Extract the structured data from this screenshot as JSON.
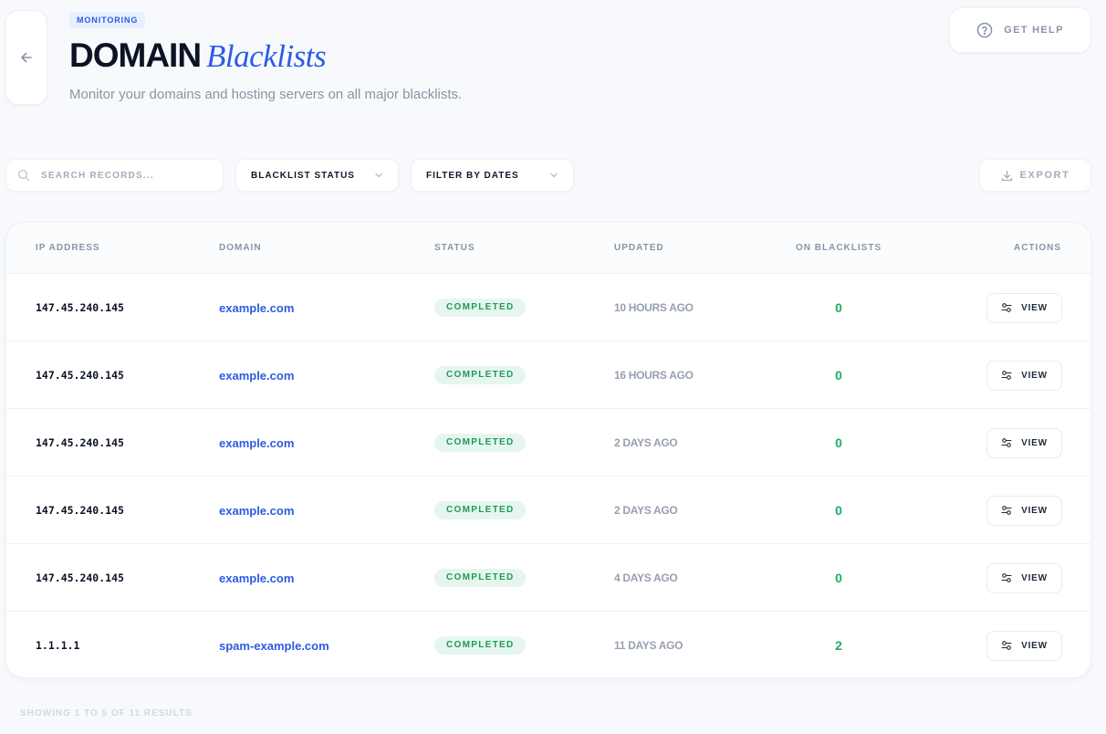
{
  "header": {
    "badge": "MONITORING",
    "title_strong": "DOMAIN",
    "title_italic": "Blacklists",
    "subtitle": "Monitor your domains and hosting servers on all major blacklists.",
    "help_label": "GET HELP"
  },
  "toolbar": {
    "search_placeholder": "SEARCH RECORDS...",
    "blacklist_status_label": "BLACKLIST STATUS",
    "filter_dates_label": "FILTER BY DATES",
    "export_label": "EXPORT"
  },
  "table": {
    "columns": {
      "ip": "IP ADDRESS",
      "domain": "DOMAIN",
      "status": "STATUS",
      "updated": "UPDATED",
      "on_blacklists": "ON BLACKLISTS",
      "actions": "ACTIONS"
    },
    "rows": [
      {
        "ip": "147.45.240.145",
        "domain": "example.com",
        "status": "COMPLETED",
        "updated": "10 HOURS AGO",
        "count": "0",
        "action": "VIEW"
      },
      {
        "ip": "147.45.240.145",
        "domain": "example.com",
        "status": "COMPLETED",
        "updated": "16 HOURS AGO",
        "count": "0",
        "action": "VIEW"
      },
      {
        "ip": "147.45.240.145",
        "domain": "example.com",
        "status": "COMPLETED",
        "updated": "2 DAYS AGO",
        "count": "0",
        "action": "VIEW"
      },
      {
        "ip": "147.45.240.145",
        "domain": "example.com",
        "status": "COMPLETED",
        "updated": "2 DAYS AGO",
        "count": "0",
        "action": "VIEW"
      },
      {
        "ip": "147.45.240.145",
        "domain": "example.com",
        "status": "COMPLETED",
        "updated": "4 DAYS AGO",
        "count": "0",
        "action": "VIEW"
      },
      {
        "ip": "1.1.1.1",
        "domain": "spam-example.com",
        "status": "COMPLETED",
        "updated": "11 DAYS AGO",
        "count": "2",
        "action": "VIEW"
      }
    ]
  },
  "footer": {
    "results_text": "SHOWING 1 TO 5 OF 11 RESULTS"
  },
  "colors": {
    "accent": "#2d5be3",
    "success": "#1bae63",
    "background": "#f7f9fc"
  },
  "icons": [
    "arrow-left-icon",
    "help-circle-icon",
    "search-icon",
    "chevron-down-icon",
    "download-icon",
    "sliders-icon"
  ]
}
